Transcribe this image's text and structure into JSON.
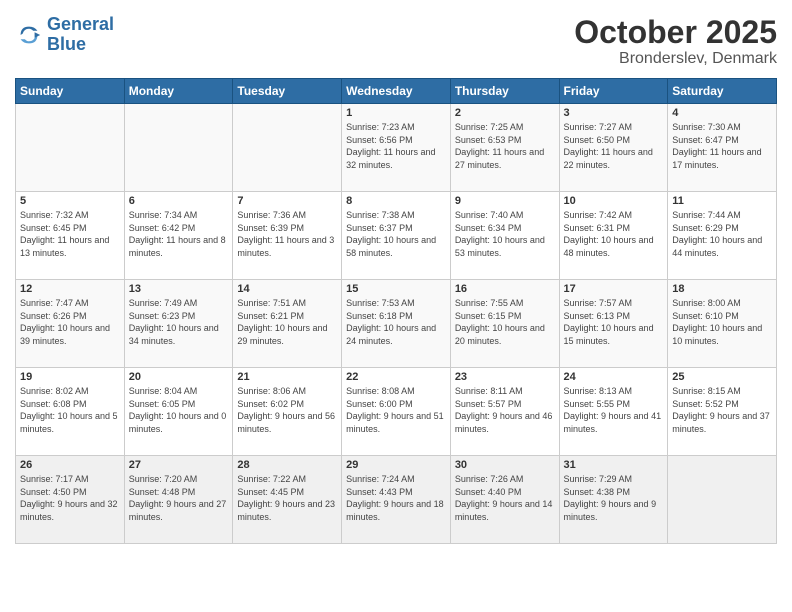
{
  "logo": {
    "line1": "General",
    "line2": "Blue"
  },
  "title": "October 2025",
  "subtitle": "Bronderslev, Denmark",
  "days_of_week": [
    "Sunday",
    "Monday",
    "Tuesday",
    "Wednesday",
    "Thursday",
    "Friday",
    "Saturday"
  ],
  "weeks": [
    [
      {
        "num": "",
        "sunrise": "",
        "sunset": "",
        "daylight": ""
      },
      {
        "num": "",
        "sunrise": "",
        "sunset": "",
        "daylight": ""
      },
      {
        "num": "",
        "sunrise": "",
        "sunset": "",
        "daylight": ""
      },
      {
        "num": "1",
        "sunrise": "Sunrise: 7:23 AM",
        "sunset": "Sunset: 6:56 PM",
        "daylight": "Daylight: 11 hours and 32 minutes."
      },
      {
        "num": "2",
        "sunrise": "Sunrise: 7:25 AM",
        "sunset": "Sunset: 6:53 PM",
        "daylight": "Daylight: 11 hours and 27 minutes."
      },
      {
        "num": "3",
        "sunrise": "Sunrise: 7:27 AM",
        "sunset": "Sunset: 6:50 PM",
        "daylight": "Daylight: 11 hours and 22 minutes."
      },
      {
        "num": "4",
        "sunrise": "Sunrise: 7:30 AM",
        "sunset": "Sunset: 6:47 PM",
        "daylight": "Daylight: 11 hours and 17 minutes."
      }
    ],
    [
      {
        "num": "5",
        "sunrise": "Sunrise: 7:32 AM",
        "sunset": "Sunset: 6:45 PM",
        "daylight": "Daylight: 11 hours and 13 minutes."
      },
      {
        "num": "6",
        "sunrise": "Sunrise: 7:34 AM",
        "sunset": "Sunset: 6:42 PM",
        "daylight": "Daylight: 11 hours and 8 minutes."
      },
      {
        "num": "7",
        "sunrise": "Sunrise: 7:36 AM",
        "sunset": "Sunset: 6:39 PM",
        "daylight": "Daylight: 11 hours and 3 minutes."
      },
      {
        "num": "8",
        "sunrise": "Sunrise: 7:38 AM",
        "sunset": "Sunset: 6:37 PM",
        "daylight": "Daylight: 10 hours and 58 minutes."
      },
      {
        "num": "9",
        "sunrise": "Sunrise: 7:40 AM",
        "sunset": "Sunset: 6:34 PM",
        "daylight": "Daylight: 10 hours and 53 minutes."
      },
      {
        "num": "10",
        "sunrise": "Sunrise: 7:42 AM",
        "sunset": "Sunset: 6:31 PM",
        "daylight": "Daylight: 10 hours and 48 minutes."
      },
      {
        "num": "11",
        "sunrise": "Sunrise: 7:44 AM",
        "sunset": "Sunset: 6:29 PM",
        "daylight": "Daylight: 10 hours and 44 minutes."
      }
    ],
    [
      {
        "num": "12",
        "sunrise": "Sunrise: 7:47 AM",
        "sunset": "Sunset: 6:26 PM",
        "daylight": "Daylight: 10 hours and 39 minutes."
      },
      {
        "num": "13",
        "sunrise": "Sunrise: 7:49 AM",
        "sunset": "Sunset: 6:23 PM",
        "daylight": "Daylight: 10 hours and 34 minutes."
      },
      {
        "num": "14",
        "sunrise": "Sunrise: 7:51 AM",
        "sunset": "Sunset: 6:21 PM",
        "daylight": "Daylight: 10 hours and 29 minutes."
      },
      {
        "num": "15",
        "sunrise": "Sunrise: 7:53 AM",
        "sunset": "Sunset: 6:18 PM",
        "daylight": "Daylight: 10 hours and 24 minutes."
      },
      {
        "num": "16",
        "sunrise": "Sunrise: 7:55 AM",
        "sunset": "Sunset: 6:15 PM",
        "daylight": "Daylight: 10 hours and 20 minutes."
      },
      {
        "num": "17",
        "sunrise": "Sunrise: 7:57 AM",
        "sunset": "Sunset: 6:13 PM",
        "daylight": "Daylight: 10 hours and 15 minutes."
      },
      {
        "num": "18",
        "sunrise": "Sunrise: 8:00 AM",
        "sunset": "Sunset: 6:10 PM",
        "daylight": "Daylight: 10 hours and 10 minutes."
      }
    ],
    [
      {
        "num": "19",
        "sunrise": "Sunrise: 8:02 AM",
        "sunset": "Sunset: 6:08 PM",
        "daylight": "Daylight: 10 hours and 5 minutes."
      },
      {
        "num": "20",
        "sunrise": "Sunrise: 8:04 AM",
        "sunset": "Sunset: 6:05 PM",
        "daylight": "Daylight: 10 hours and 0 minutes."
      },
      {
        "num": "21",
        "sunrise": "Sunrise: 8:06 AM",
        "sunset": "Sunset: 6:02 PM",
        "daylight": "Daylight: 9 hours and 56 minutes."
      },
      {
        "num": "22",
        "sunrise": "Sunrise: 8:08 AM",
        "sunset": "Sunset: 6:00 PM",
        "daylight": "Daylight: 9 hours and 51 minutes."
      },
      {
        "num": "23",
        "sunrise": "Sunrise: 8:11 AM",
        "sunset": "Sunset: 5:57 PM",
        "daylight": "Daylight: 9 hours and 46 minutes."
      },
      {
        "num": "24",
        "sunrise": "Sunrise: 8:13 AM",
        "sunset": "Sunset: 5:55 PM",
        "daylight": "Daylight: 9 hours and 41 minutes."
      },
      {
        "num": "25",
        "sunrise": "Sunrise: 8:15 AM",
        "sunset": "Sunset: 5:52 PM",
        "daylight": "Daylight: 9 hours and 37 minutes."
      }
    ],
    [
      {
        "num": "26",
        "sunrise": "Sunrise: 7:17 AM",
        "sunset": "Sunset: 4:50 PM",
        "daylight": "Daylight: 9 hours and 32 minutes."
      },
      {
        "num": "27",
        "sunrise": "Sunrise: 7:20 AM",
        "sunset": "Sunset: 4:48 PM",
        "daylight": "Daylight: 9 hours and 27 minutes."
      },
      {
        "num": "28",
        "sunrise": "Sunrise: 7:22 AM",
        "sunset": "Sunset: 4:45 PM",
        "daylight": "Daylight: 9 hours and 23 minutes."
      },
      {
        "num": "29",
        "sunrise": "Sunrise: 7:24 AM",
        "sunset": "Sunset: 4:43 PM",
        "daylight": "Daylight: 9 hours and 18 minutes."
      },
      {
        "num": "30",
        "sunrise": "Sunrise: 7:26 AM",
        "sunset": "Sunset: 4:40 PM",
        "daylight": "Daylight: 9 hours and 14 minutes."
      },
      {
        "num": "31",
        "sunrise": "Sunrise: 7:29 AM",
        "sunset": "Sunset: 4:38 PM",
        "daylight": "Daylight: 9 hours and 9 minutes."
      },
      {
        "num": "",
        "sunrise": "",
        "sunset": "",
        "daylight": ""
      }
    ]
  ]
}
